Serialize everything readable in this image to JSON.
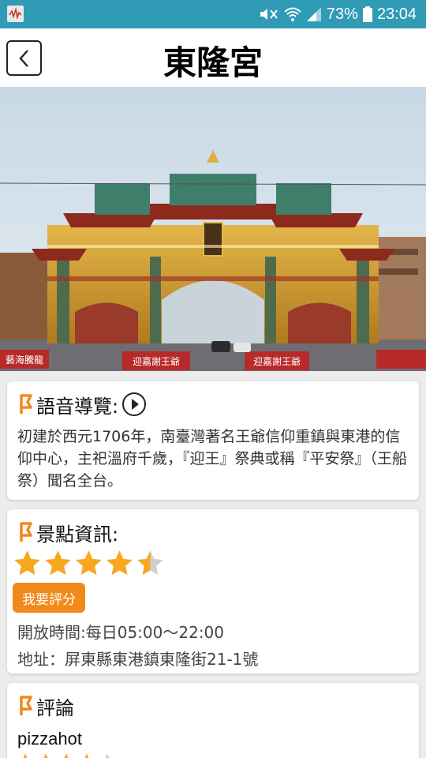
{
  "status_bar": {
    "battery_percent": "73%",
    "time": "23:04",
    "icons": [
      "app-notification-icon",
      "mute-icon",
      "wifi-icon",
      "signal-icon",
      "battery-icon"
    ]
  },
  "header": {
    "title": "東隆宮",
    "back_icon": "chevron-left-icon"
  },
  "hero_image": {
    "signboards": [
      "藝海騰龍",
      "迎嘉謝王爺",
      "迎嘉謝王爺"
    ]
  },
  "audio_guide": {
    "title": "語音導覽:",
    "description": "初建於西元1706年，南臺灣著名王爺信仰重鎮與東港的信仰中心，主祀溫府千歲，『迎王』祭典或稱『平安祭』（王船祭）聞名全台。"
  },
  "spot_info": {
    "title": "景點資訊:",
    "rating": 4.5,
    "rating_max": 5,
    "rate_button": "我要評分",
    "hours": "開放時間:每日05:00～22:00",
    "address": "地址：屏東縣東港鎮東隆街21-1號"
  },
  "reviews": {
    "title": "評論",
    "items": [
      {
        "user": "pizzahot",
        "rating": 4,
        "rating_max": 5
      }
    ]
  },
  "colors": {
    "status_bar": "#2f9bb5",
    "accent_orange": "#f28a1b",
    "star_gold": "#f7a81e",
    "star_empty": "#cfcfcf"
  }
}
